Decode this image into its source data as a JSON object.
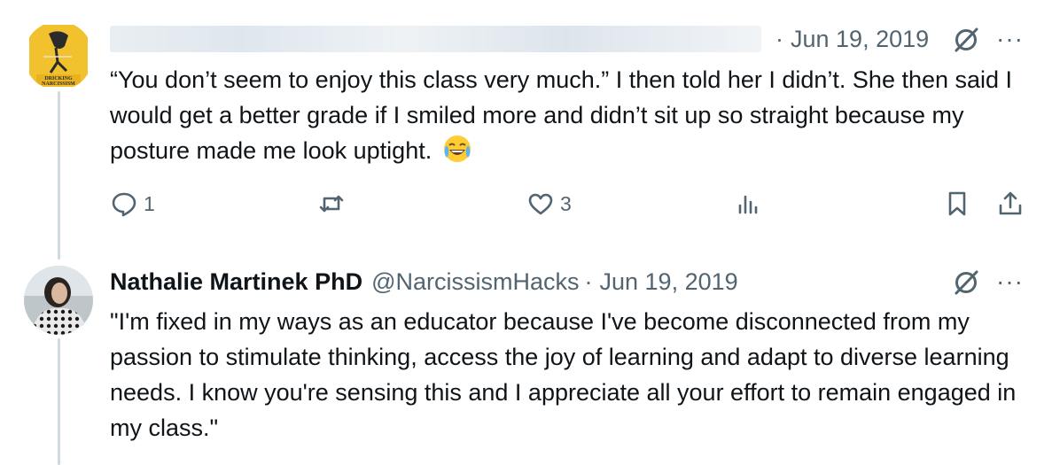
{
  "tweet1": {
    "date": "Jun 19, 2019",
    "separator": "·",
    "text": "“You don’t seem to enjoy this class very much.” I then told her I didn’t. She then said I would get a better grade if I smiled more and didn’t sit up so straight because my posture made me look uptight.",
    "emoji": "face-with-tears-of-joy",
    "avatar_text": "DRICKING NARCISSISM",
    "actions": {
      "reply_count": "1",
      "repost_count": "",
      "like_count": "3",
      "views_count": ""
    }
  },
  "tweet2": {
    "author_name": "Nathalie Martinek PhD",
    "handle": "@NarcissismHacks",
    "separator": "·",
    "date": "Jun 19, 2019",
    "text": "\"I'm fixed in my ways as an educator because I've become disconnected from my passion to stimulate thinking, access the joy of learning and adapt to diverse learning needs. I know you're sensing this and I appreciate all your effort to remain engaged in my class.\""
  },
  "more_label": "···",
  "colors": {
    "text": "#0f1419",
    "secondary": "#536471",
    "thread_line": "#cfd9de",
    "avatar1_bg": "#f2c12e"
  }
}
